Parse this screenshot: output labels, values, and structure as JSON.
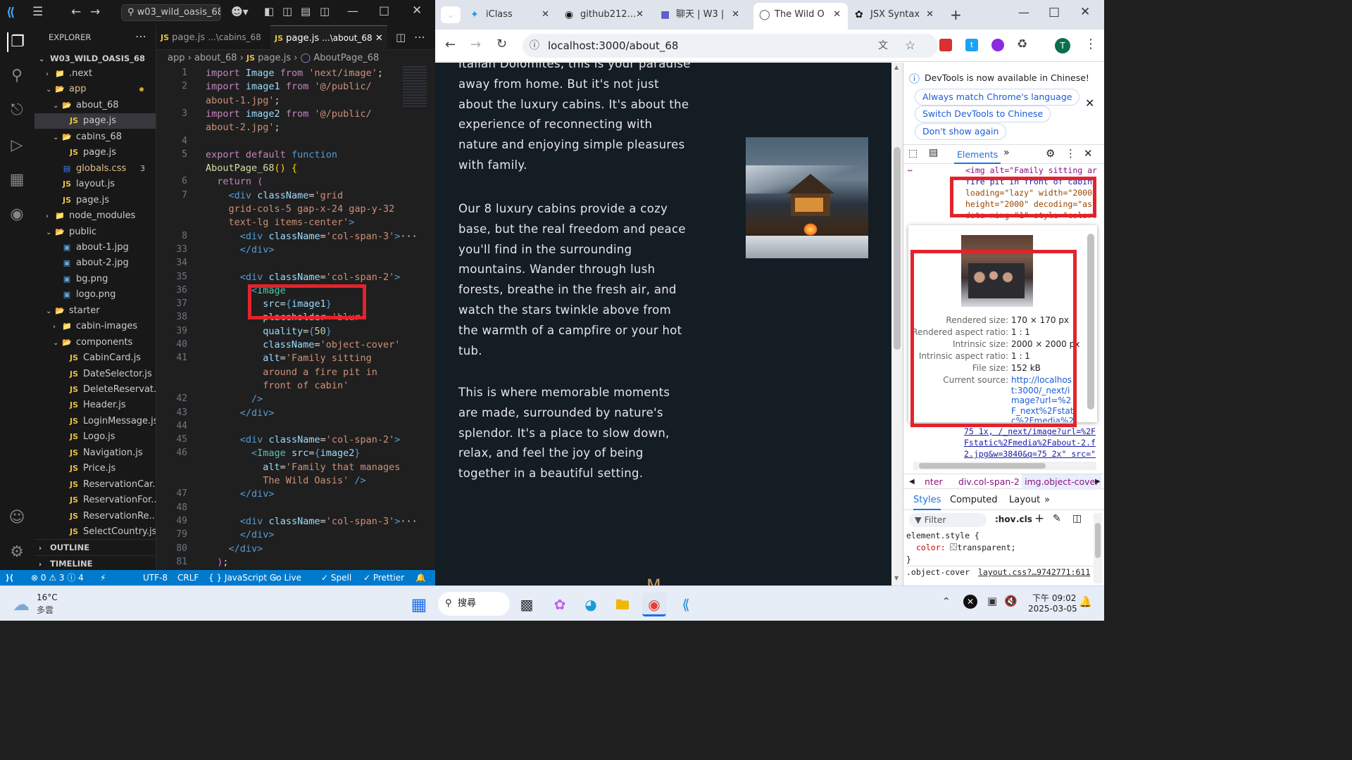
{
  "vscode": {
    "search_title": "w03_wild_oasis_68",
    "explorer_label": "EXPLORER",
    "project_name": "W03_WILD_OASIS_68",
    "tree": [
      {
        "label": ".next",
        "indent": 1,
        "kind": "folder-closed",
        "icon": "next-folder-icon"
      },
      {
        "label": "app",
        "indent": 1,
        "kind": "folder-open",
        "icon": "app-folder-icon",
        "dot": true
      },
      {
        "label": "about_68",
        "indent": 2,
        "kind": "folder-open",
        "icon": "folder-icon"
      },
      {
        "label": "page.js",
        "indent": 3,
        "kind": "js",
        "icon": "js-file-icon",
        "selected": true
      },
      {
        "label": "cabins_68",
        "indent": 2,
        "kind": "folder-open",
        "icon": "folder-icon"
      },
      {
        "label": "page.js",
        "indent": 3,
        "kind": "js",
        "icon": "js-file-icon"
      },
      {
        "label": "globals.css",
        "indent": 2,
        "kind": "css",
        "icon": "css-file-icon",
        "badge": "3"
      },
      {
        "label": "layout.js",
        "indent": 2,
        "kind": "js",
        "icon": "js-file-icon"
      },
      {
        "label": "page.js",
        "indent": 2,
        "kind": "js",
        "icon": "js-file-icon"
      },
      {
        "label": "node_modules",
        "indent": 1,
        "kind": "folder-closed",
        "icon": "node-folder-icon"
      },
      {
        "label": "public",
        "indent": 1,
        "kind": "folder-open",
        "icon": "public-folder-icon"
      },
      {
        "label": "about-1.jpg",
        "indent": 2,
        "kind": "img",
        "icon": "image-file-icon"
      },
      {
        "label": "about-2.jpg",
        "indent": 2,
        "kind": "img",
        "icon": "image-file-icon"
      },
      {
        "label": "bg.png",
        "indent": 2,
        "kind": "img",
        "icon": "image-file-icon"
      },
      {
        "label": "logo.png",
        "indent": 2,
        "kind": "img",
        "icon": "image-file-icon"
      },
      {
        "label": "starter",
        "indent": 1,
        "kind": "folder-open",
        "icon": "folder-icon"
      },
      {
        "label": "cabin-images",
        "indent": 2,
        "kind": "folder-closed",
        "icon": "folder-icon"
      },
      {
        "label": "components",
        "indent": 2,
        "kind": "folder-open",
        "icon": "components-folder-icon"
      },
      {
        "label": "CabinCard.js",
        "indent": 3,
        "kind": "js",
        "icon": "js-file-icon"
      },
      {
        "label": "DateSelector.js",
        "indent": 3,
        "kind": "js",
        "icon": "js-file-icon"
      },
      {
        "label": "DeleteReservat...",
        "indent": 3,
        "kind": "js",
        "icon": "js-file-icon"
      },
      {
        "label": "Header.js",
        "indent": 3,
        "kind": "js",
        "icon": "js-file-icon"
      },
      {
        "label": "LoginMessage.js",
        "indent": 3,
        "kind": "js",
        "icon": "js-file-icon"
      },
      {
        "label": "Logo.js",
        "indent": 3,
        "kind": "js",
        "icon": "js-file-icon"
      },
      {
        "label": "Navigation.js",
        "indent": 3,
        "kind": "js",
        "icon": "js-file-icon"
      },
      {
        "label": "Price.js",
        "indent": 3,
        "kind": "js",
        "icon": "js-file-icon"
      },
      {
        "label": "ReservationCar...",
        "indent": 3,
        "kind": "js",
        "icon": "js-file-icon"
      },
      {
        "label": "ReservationFor...",
        "indent": 3,
        "kind": "js",
        "icon": "js-file-icon"
      },
      {
        "label": "ReservationRe...",
        "indent": 3,
        "kind": "js",
        "icon": "js-file-icon"
      },
      {
        "label": "SelectCountry.js",
        "indent": 3,
        "kind": "js",
        "icon": "js-file-icon"
      }
    ],
    "outline_label": "OUTLINE",
    "timeline_label": "TIMELINE",
    "tabs": [
      {
        "label": "page.js",
        "sub": "...\\cabins_68"
      },
      {
        "label": "page.js",
        "sub": "...\\about_68",
        "active": true
      }
    ],
    "breadcrumb": [
      "app",
      "about_68",
      "page.js",
      "AboutPage_68"
    ],
    "code_lines": [
      {
        "n": "1",
        "html": "<span class='kw'>import</span> <span class='at'>Image</span> <span class='kw'>from</span> <span class='str'>'next/image'</span>;"
      },
      {
        "n": "2",
        "html": "<span class='kw'>import</span> <span class='at'>image1</span> <span class='kw'>from</span> <span class='str'>'@/public/</span>"
      },
      {
        "n": "",
        "html": "<span class='str'>about-1.jpg'</span>;"
      },
      {
        "n": "3",
        "html": "<span class='kw'>import</span> <span class='at'>image2</span> <span class='kw'>from</span> <span class='str'>'@/public/</span>"
      },
      {
        "n": "",
        "html": "<span class='str'>about-2.jpg'</span>;"
      },
      {
        "n": "4",
        "html": ""
      },
      {
        "n": "5",
        "html": "<span class='kw'>export</span> <span class='kw'>default</span> <span class='k2'>function</span>"
      },
      {
        "n": "",
        "html": "<span class='fn'>AboutPage_68</span><span class='br2'>()</span> <span class='br2'>{</span>"
      },
      {
        "n": "6",
        "html": "  <span class='kw'>return</span> <span class='br'>(</span>"
      },
      {
        "n": "7",
        "html": "    <span class='tg'>&lt;</span><span class='tg'>div</span> <span class='at'>className</span>=<span class='str'>'grid</span>"
      },
      {
        "n": "",
        "html": "    <span class='str'>grid-cols-5 gap-x-24 gap-y-32</span>"
      },
      {
        "n": "",
        "html": "    <span class='str'>text-lg items-center'</span><span class='tg'>&gt;</span>"
      },
      {
        "n": "8",
        "html": "      <span class='tg'>&lt;div</span> <span class='at'>className</span>=<span class='str'>'col-span-3'</span><span class='tg'>&gt;</span>···"
      },
      {
        "n": "33",
        "html": "      <span class='tg'>&lt;/div&gt;</span>"
      },
      {
        "n": "34",
        "html": ""
      },
      {
        "n": "35",
        "html": "      <span class='tg'>&lt;div</span> <span class='at'>className</span>=<span class='str'>'col-span-2'</span><span class='tg'>&gt;</span>"
      },
      {
        "n": "36",
        "html": "        <span class='tg'>&lt;</span><span class='tag'>Image</span>"
      },
      {
        "n": "37",
        "html": "          <span class='at'>src</span>=<span class='k2'>{</span><span class='at'>image1</span><span class='k2'>}</span>"
      },
      {
        "n": "38",
        "html": "          <span class='at'>placeholder</span>=<span class='str'>'blur'</span>"
      },
      {
        "n": "39",
        "html": "          <span class='at'>quality</span>=<span class='k2'>{</span><span class='num'>50</span><span class='k2'>}</span>"
      },
      {
        "n": "40",
        "html": "          <span class='at'>className</span>=<span class='str'>'object-cover'</span>"
      },
      {
        "n": "41",
        "html": "          <span class='at'>alt</span>=<span class='str'>'Family sitting</span>"
      },
      {
        "n": "",
        "html": "          <span class='str'>around a fire pit in</span>"
      },
      {
        "n": "",
        "html": "          <span class='str'>front of cabin'</span>"
      },
      {
        "n": "42",
        "html": "        <span class='tg'>/&gt;</span>"
      },
      {
        "n": "43",
        "html": "      <span class='tg'>&lt;/div&gt;</span>"
      },
      {
        "n": "44",
        "html": ""
      },
      {
        "n": "45",
        "html": "      <span class='tg'>&lt;div</span> <span class='at'>className</span>=<span class='str'>'col-span-2'</span><span class='tg'>&gt;</span>"
      },
      {
        "n": "46",
        "html": "        <span class='tg'>&lt;</span><span class='tag'>Image</span> <span class='at'>src</span>=<span class='k2'>{</span><span class='at'>image2</span><span class='k2'>}</span>"
      },
      {
        "n": "",
        "html": "          <span class='at'>alt</span>=<span class='str'>'Family that manages</span>"
      },
      {
        "n": "",
        "html": "          <span class='str'>The Wild Oasis'</span> <span class='tg'>/&gt;</span>"
      },
      {
        "n": "47",
        "html": "      <span class='tg'>&lt;/div&gt;</span>"
      },
      {
        "n": "48",
        "html": ""
      },
      {
        "n": "49",
        "html": "      <span class='tg'>&lt;div</span> <span class='at'>className</span>=<span class='str'>'col-span-3'</span><span class='tg'>&gt;</span>···"
      },
      {
        "n": "79",
        "html": "      <span class='tg'>&lt;/div&gt;</span>"
      },
      {
        "n": "80",
        "html": "    <span class='tg'>&lt;/div&gt;</span>"
      },
      {
        "n": "81",
        "html": "  <span class='br'>)</span>;"
      }
    ],
    "status": {
      "problems": "⊗ 0 ⚠ 3 ⓘ 4",
      "encoding": "UTF-8",
      "eol": "CRLF",
      "language": "{ } JavaScript",
      "golive": "Go Live",
      "spell": "✓ Spell",
      "prettier": "✓ Prettier"
    }
  },
  "browser": {
    "tabs": [
      {
        "label": "iClass",
        "icon": "iclass-icon"
      },
      {
        "label": "github212…",
        "icon": "github-icon"
      },
      {
        "label": "聊天 | W3 |",
        "icon": "teams-icon"
      },
      {
        "label": "The Wild O",
        "icon": "globe-icon",
        "active": true
      },
      {
        "label": "JSX Syntax",
        "icon": "chatgpt-icon"
      }
    ],
    "url": "localhost:3000/about_68",
    "avatar_letter": "T",
    "paragraphs": [
      "Italian Dolomites, this is your paradise away from home. But it's not just about the luxury cabins. It's about the experience of reconnecting with nature and enjoying simple pleasures with family.",
      "Our 8 luxury cabins provide a cozy base, but the real freedom and peace you'll find in the surrounding mountains. Wander through lush forests, breathe in the fresh air, and watch the stars twinkle above from the warmth of a campfire or your hot tub.",
      "This is where memorable moments are made, surrounded by nature's splendor. It's a place to slow down, relax, and feel the joy of being together in a beautiful setting."
    ]
  },
  "devtools": {
    "banner": "DevTools is now available in Chinese!",
    "btn_match": "Always match Chrome's language",
    "btn_switch": "Switch DevTools to Chinese",
    "btn_dont": "Don't show again",
    "tab_elements": "Elements",
    "html_lines": [
      "<img alt=\"Family sitting ar",
      "fire pit in front of cabin",
      "loading=\"lazy\" width=\"2000\"",
      "height=\"2000\" decoding=\"asy",
      "data-nimg=\"1\" style=\"color:"
    ],
    "tooltip": {
      "rendered_size_label": "Rendered size:",
      "rendered_size": "170 × 170 px",
      "rendered_ratio_label": "Rendered aspect ratio:",
      "rendered_ratio": "1 : 1",
      "intrinsic_size_label": "Intrinsic size:",
      "intrinsic_size": "2000 × 2000 px",
      "intrinsic_ratio_label": "Intrinsic aspect ratio:",
      "intrinsic_ratio": "1 : 1",
      "file_size_label": "File size:",
      "file_size": "152 kB",
      "source_label": "Current source:",
      "source": "http://localhost:3000/_next/image?url=%2F_next%2Fstatic%2Fmedia%2Fabout-"
    },
    "srcset_lines": [
      "75 1x, /_next/image?url=%2F",
      "Fstatic%2Fmedia%2Fabout-2.f",
      "2.jpg&w=3840&q=75 2x\" src=\""
    ],
    "crumbs": [
      "nter",
      "div.col-span-2",
      "img.object-cover"
    ],
    "styles_tabs": [
      "Styles",
      "Computed",
      "Layout"
    ],
    "filter_placeholder": "Filter",
    "hov": ":hov",
    "cls": ".cls",
    "element_style": "element.style {",
    "color_prop": "color:",
    "color_val": "transparent;",
    "close_brace": "}",
    "object_cover": ".object-cover",
    "layout_link": "layout.css?…9742771:611"
  },
  "taskbar": {
    "weather_temp": "16°C",
    "weather_desc": "多雲",
    "search_label": "搜尋",
    "time": "下午 09:02",
    "date": "2025-03-05"
  },
  "colors": {
    "accent_red": "#e3232c",
    "vscode_status": "#007acc",
    "page_bg": "#141c24"
  }
}
